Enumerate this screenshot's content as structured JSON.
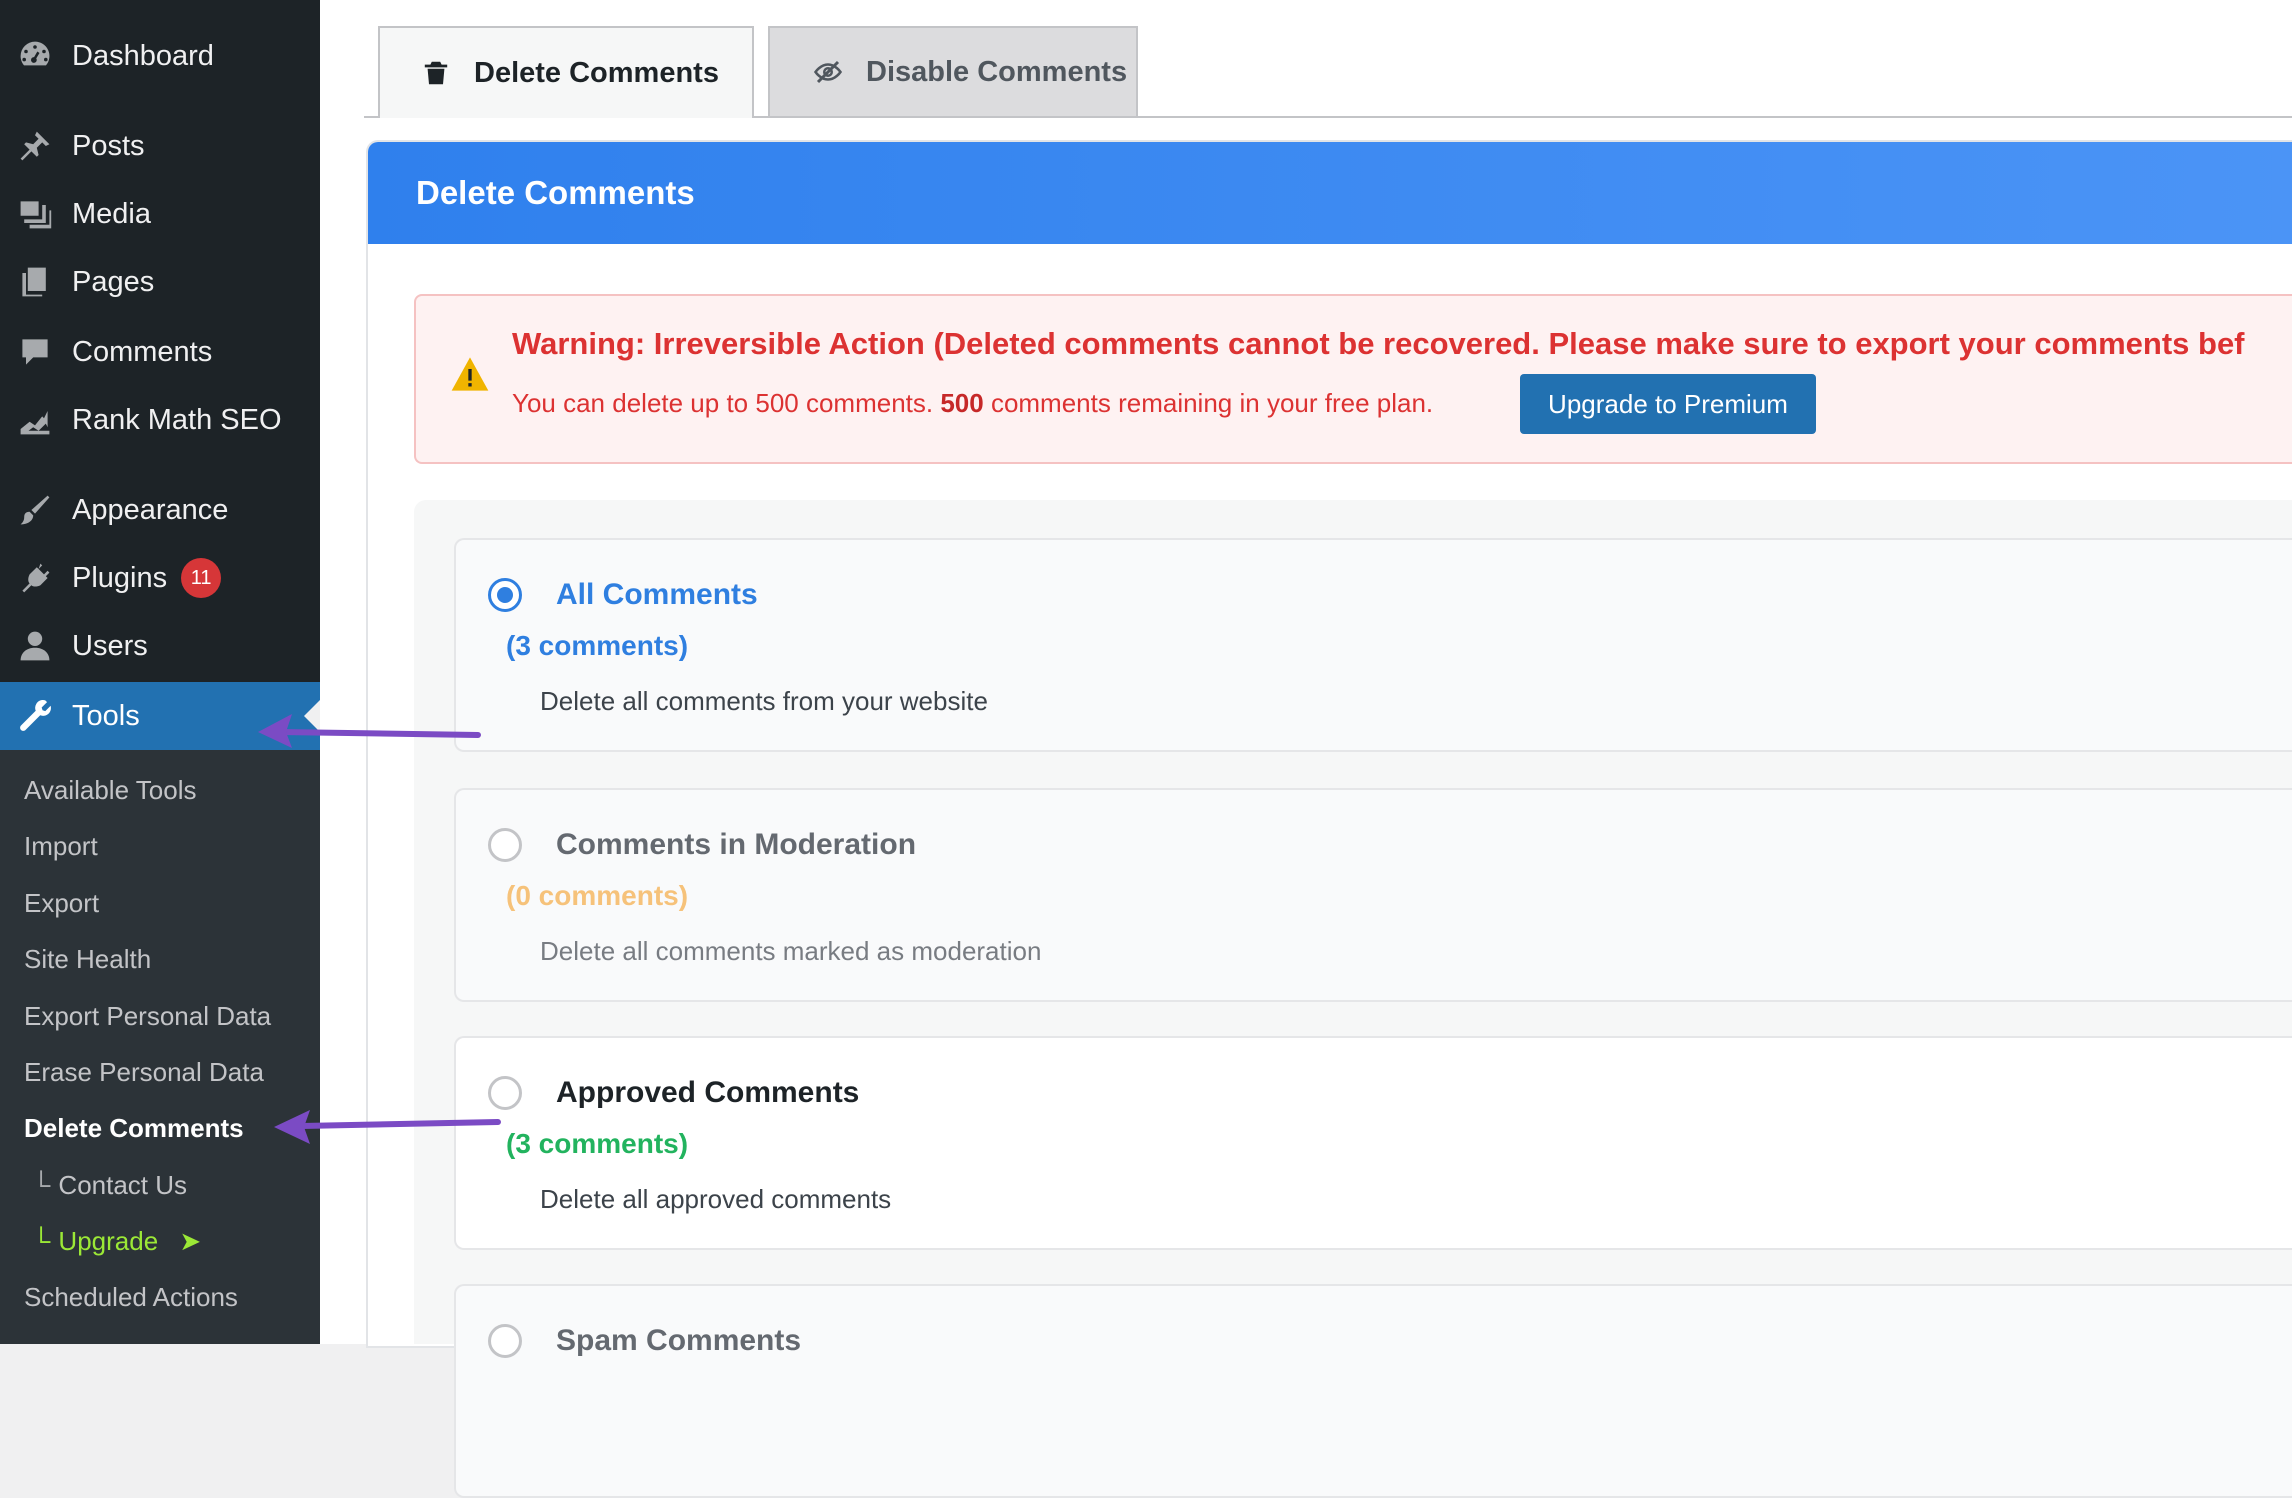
{
  "sidebar": {
    "menu": [
      {
        "label": "Dashboard",
        "icon": "dashboard-icon"
      },
      {
        "label": "Posts",
        "icon": "pin-icon"
      },
      {
        "label": "Media",
        "icon": "media-icon"
      },
      {
        "label": "Pages",
        "icon": "pages-icon"
      },
      {
        "label": "Comments",
        "icon": "comment-icon"
      },
      {
        "label": "Rank Math SEO",
        "icon": "rank-math-icon"
      },
      {
        "label": "Appearance",
        "icon": "brush-icon"
      },
      {
        "label": "Plugins",
        "icon": "plugin-icon",
        "badge": "11"
      },
      {
        "label": "Users",
        "icon": "user-icon"
      },
      {
        "label": "Tools",
        "icon": "wrench-icon",
        "active": true
      }
    ],
    "submenu": [
      {
        "label": "Available Tools"
      },
      {
        "label": "Import"
      },
      {
        "label": "Export"
      },
      {
        "label": "Site Health"
      },
      {
        "label": "Export Personal Data"
      },
      {
        "label": "Erase Personal Data"
      },
      {
        "label": "Delete Comments",
        "current": true
      },
      {
        "label": "Contact Us",
        "elbow": "└"
      },
      {
        "label": "Upgrade",
        "elbow": "└",
        "suffix": "➤"
      },
      {
        "label": "Scheduled Actions"
      }
    ]
  },
  "tabs": [
    {
      "label": "Delete Comments",
      "icon": "trash-icon",
      "active": true
    },
    {
      "label": "Disable Comments",
      "icon": "eye-slash-icon",
      "active": false
    }
  ],
  "panel": {
    "title": "Delete Comments"
  },
  "warning": {
    "title": "Warning: Irreversible Action (Deleted comments cannot be recovered. Please make sure to export your comments bef",
    "text_before": "You can delete up to 500 comments. ",
    "remaining": "500",
    "text_after": " comments remaining in your free plan.",
    "button": "Upgrade to Premium"
  },
  "options": [
    {
      "title": "All Comments",
      "count": "(3 comments)",
      "desc": "Delete all comments from your website",
      "checked": true,
      "title_color": "#2f7fe0",
      "count_color": "#2f7fe0"
    },
    {
      "title": "Comments in Moderation",
      "count": "(0 comments)",
      "desc": "Delete all comments marked as moderation",
      "checked": false,
      "title_color": "#646970",
      "count_color": "#f6c27a"
    },
    {
      "title": "Approved Comments",
      "count": "(3 comments)",
      "desc": "Delete all approved comments",
      "checked": false,
      "title_color": "#1d2327",
      "count_color": "#22b35e"
    },
    {
      "title": "Spam Comments",
      "count": "",
      "desc": "",
      "checked": false,
      "title_color": "#646970",
      "count_color": "#646970"
    }
  ],
  "colors": {
    "sidebar_bg": "#1d2327",
    "active_menu": "#2271b1",
    "header_blue": "#2f80ed",
    "warning_red": "#dc3232",
    "annotation_arrow": "#7b4bc4"
  }
}
